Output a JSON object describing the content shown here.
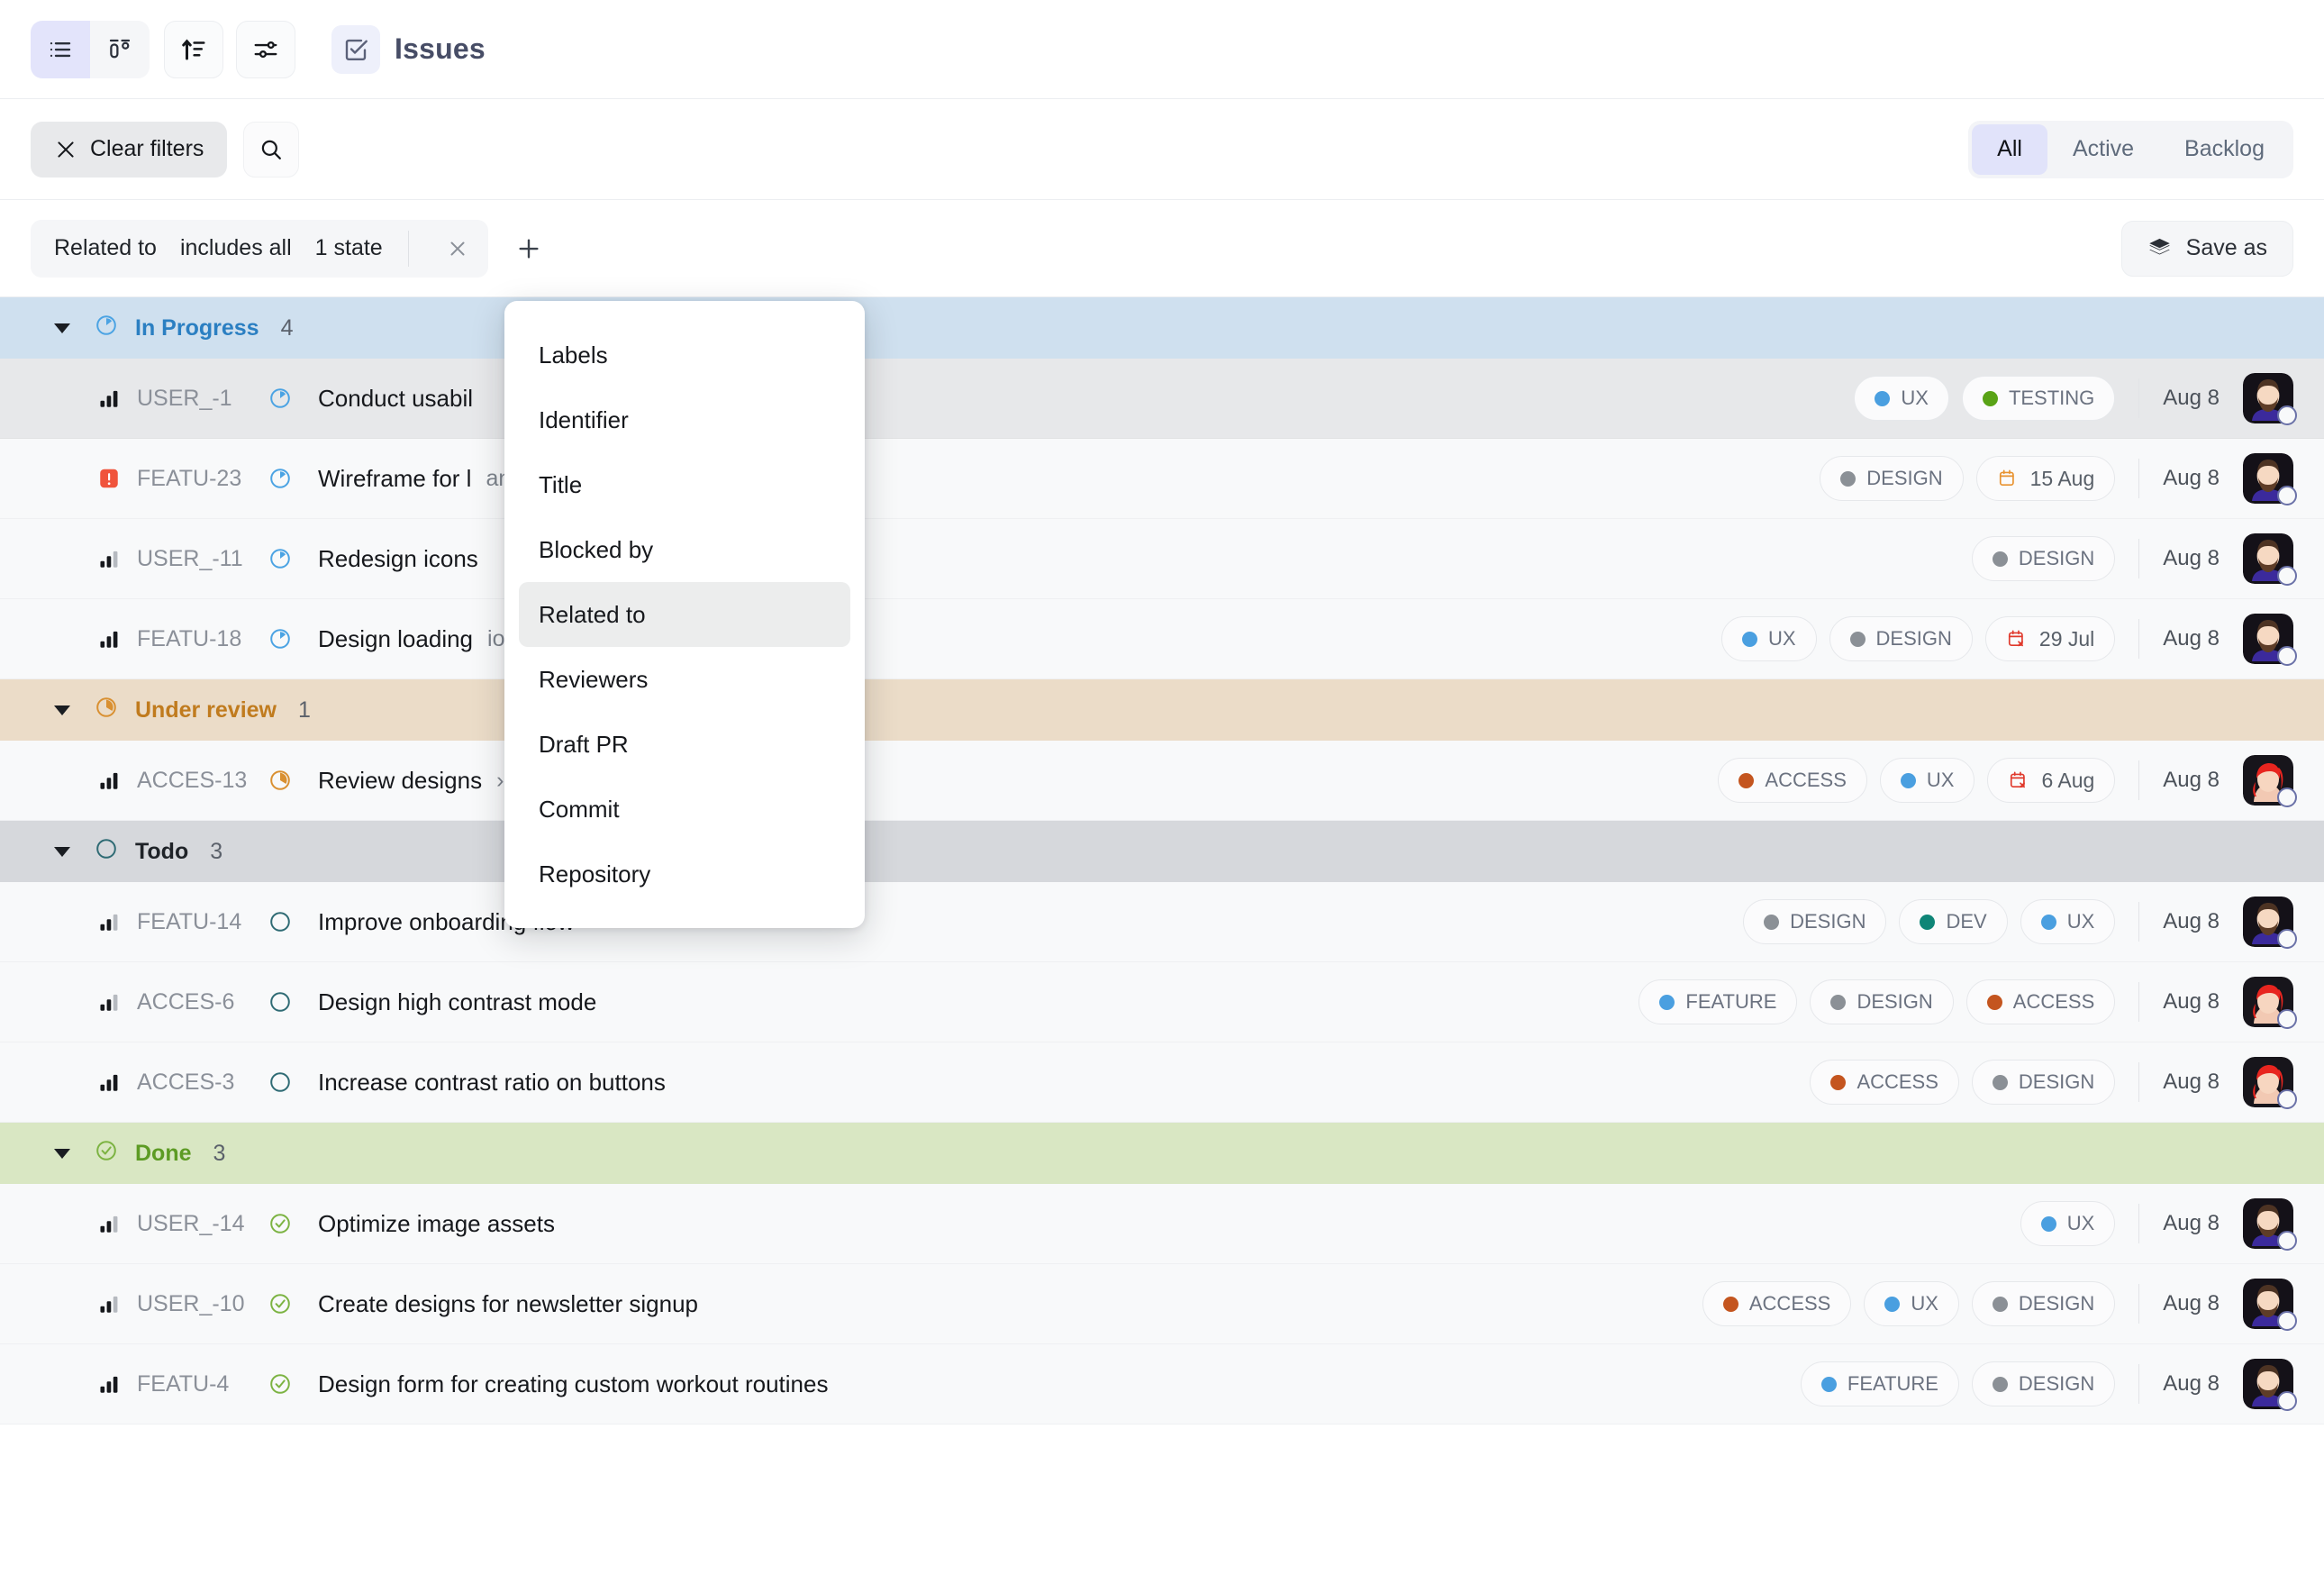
{
  "toolbar": {
    "views": [
      {
        "name": "list-view",
        "icon": "list-icon",
        "active": true
      },
      {
        "name": "board-view",
        "icon": "board-icon",
        "active": false
      }
    ],
    "sort_icon": "sort-ascending-icon",
    "filter_icon": "sliders-icon",
    "title_icon": "checkbox-check-icon",
    "title": "Issues"
  },
  "filterbar": {
    "clear_filters_label": "Clear filters",
    "clear_icon": "close-x-icon",
    "search_icon": "search-icon",
    "tabs": [
      {
        "label": "All",
        "active": true
      },
      {
        "label": "Active",
        "active": false
      },
      {
        "label": "Backlog",
        "active": false
      }
    ]
  },
  "active_filters": {
    "chip": {
      "field": "Related to",
      "operator": "includes all",
      "value": "1 state",
      "remove_icon": "close-x-icon"
    },
    "add_icon": "plus-icon",
    "save_as_label": "Save as",
    "save_as_icon": "layers-icon"
  },
  "dropdown": {
    "items": [
      {
        "label": "Labels",
        "active": false
      },
      {
        "label": "Identifier",
        "active": false
      },
      {
        "label": "Title",
        "active": false
      },
      {
        "label": "Blocked by",
        "active": false
      },
      {
        "label": "Related to",
        "active": true
      },
      {
        "label": "Reviewers",
        "active": false
      },
      {
        "label": "Draft PR",
        "active": false
      },
      {
        "label": "Commit",
        "active": false
      },
      {
        "label": "Repository",
        "active": false
      }
    ]
  },
  "colors": {
    "in_progress": "#4ba3e3",
    "under_review": "#d99031",
    "todo": "#2f6b74",
    "done": "#7cb342",
    "label_design": "#8b9096",
    "label_dev": "#0f8577",
    "label_ux": "#4a9fe0",
    "label_feature": "#4a9fe0",
    "label_access": "#c4551f",
    "label_testing": "#59a316",
    "urgent": "#f0543c",
    "due_soon": "#e8922f",
    "due_overdue": "#e0392c"
  },
  "groups": [
    {
      "name": "In Progress",
      "count": "4",
      "state_icon": "in-progress-icon",
      "color": "#2b7fc2",
      "bg": "#cfe0ef",
      "rows": [
        {
          "priority": "high",
          "identifier": "USER_-1",
          "state_icon": "in-progress-icon",
          "title": "Conduct usabil",
          "subtitle": "",
          "labels": [
            {
              "text": "UX",
              "color": "#4a9fe0"
            },
            {
              "text": "TESTING",
              "color": "#59a316"
            }
          ],
          "due": null,
          "date": "Aug 8",
          "avatar": "bearded-brown-hair",
          "hover": true
        },
        {
          "priority": "urgent",
          "identifier": "FEATU-23",
          "state_icon": "in-progress-icon",
          "title": "Wireframe for l",
          "subtitle": "animation for workouts",
          "labels": [
            {
              "text": "DESIGN",
              "color": "#8b9096"
            }
          ],
          "due": {
            "text": "15 Aug",
            "status": "soon",
            "icon": "calendar-icon"
          },
          "date": "Aug 8",
          "avatar": "bearded-brown-hair",
          "hover": false
        },
        {
          "priority": "medium",
          "identifier": "USER_-11",
          "state_icon": "in-progress-icon",
          "title": "Redesign icons",
          "subtitle": "",
          "labels": [
            {
              "text": "DESIGN",
              "color": "#8b9096"
            }
          ],
          "due": null,
          "date": "Aug 8",
          "avatar": "bearded-brown-hair",
          "hover": false
        },
        {
          "priority": "high",
          "identifier": "FEATU-18",
          "state_icon": "in-progress-icon",
          "title": "Design loading",
          "subtitle": "ion for workouts",
          "labels": [
            {
              "text": "UX",
              "color": "#4a9fe0"
            },
            {
              "text": "DESIGN",
              "color": "#8b9096"
            }
          ],
          "due": {
            "text": "29 Jul",
            "status": "overdue",
            "icon": "calendar-x-icon"
          },
          "date": "Aug 8",
          "avatar": "bearded-brown-hair",
          "hover": false
        }
      ]
    },
    {
      "name": "Under review",
      "count": "1",
      "state_icon": "under-review-icon",
      "color": "#c07b1e",
      "bg": "#ebdcc8",
      "rows": [
        {
          "priority": "high",
          "identifier": "ACCES-13",
          "state_icon": "under-review-icon",
          "title": "Review designs",
          "subtitle": "› Add loading animation for workouts",
          "labels": [
            {
              "text": "ACCESS",
              "color": "#c4551f"
            },
            {
              "text": "UX",
              "color": "#4a9fe0"
            }
          ],
          "due": {
            "text": "6 Aug",
            "status": "overdue",
            "icon": "calendar-x-icon"
          },
          "date": "Aug 8",
          "avatar": "red-hair",
          "hover": false
        }
      ]
    },
    {
      "name": "Todo",
      "count": "3",
      "state_icon": "todo-icon",
      "color": "#1f2328",
      "bg": "#d6d8dc",
      "rows": [
        {
          "priority": "medium",
          "identifier": "FEATU-14",
          "state_icon": "todo-icon",
          "title": "Improve onboarding flow",
          "subtitle": "",
          "labels": [
            {
              "text": "DESIGN",
              "color": "#8b9096"
            },
            {
              "text": "DEV",
              "color": "#0f8577"
            },
            {
              "text": "UX",
              "color": "#4a9fe0"
            }
          ],
          "due": null,
          "date": "Aug 8",
          "avatar": "bearded-brown-hair",
          "hover": false
        },
        {
          "priority": "medium",
          "identifier": "ACCES-6",
          "state_icon": "todo-icon",
          "title": "Design high contrast mode",
          "subtitle": "",
          "labels": [
            {
              "text": "FEATURE",
              "color": "#4a9fe0"
            },
            {
              "text": "DESIGN",
              "color": "#8b9096"
            },
            {
              "text": "ACCESS",
              "color": "#c4551f"
            }
          ],
          "due": null,
          "date": "Aug 8",
          "avatar": "red-hair",
          "hover": false
        },
        {
          "priority": "high",
          "identifier": "ACCES-3",
          "state_icon": "todo-icon",
          "title": "Increase contrast ratio on buttons",
          "subtitle": "",
          "labels": [
            {
              "text": "ACCESS",
              "color": "#c4551f"
            },
            {
              "text": "DESIGN",
              "color": "#8b9096"
            }
          ],
          "due": null,
          "date": "Aug 8",
          "avatar": "red-hair",
          "hover": false
        }
      ]
    },
    {
      "name": "Done",
      "count": "3",
      "state_icon": "done-icon",
      "color": "#5d9b24",
      "bg": "#d9e7c3",
      "rows": [
        {
          "priority": "medium",
          "identifier": "USER_-14",
          "state_icon": "done-icon",
          "title": "Optimize image assets",
          "subtitle": "",
          "labels": [
            {
              "text": "UX",
              "color": "#4a9fe0"
            }
          ],
          "due": null,
          "date": "Aug 8",
          "avatar": "bearded-brown-hair",
          "hover": false
        },
        {
          "priority": "medium",
          "identifier": "USER_-10",
          "state_icon": "done-icon",
          "title": "Create designs for newsletter signup",
          "subtitle": "",
          "labels": [
            {
              "text": "ACCESS",
              "color": "#c4551f"
            },
            {
              "text": "UX",
              "color": "#4a9fe0"
            },
            {
              "text": "DESIGN",
              "color": "#8b9096"
            }
          ],
          "due": null,
          "date": "Aug 8",
          "avatar": "bearded-brown-hair",
          "hover": false
        },
        {
          "priority": "high",
          "identifier": "FEATU-4",
          "state_icon": "done-icon",
          "title": "Design form for creating custom workout routines",
          "subtitle": "",
          "labels": [
            {
              "text": "FEATURE",
              "color": "#4a9fe0"
            },
            {
              "text": "DESIGN",
              "color": "#8b9096"
            }
          ],
          "due": null,
          "date": "Aug 8",
          "avatar": "bearded-brown-hair",
          "hover": false
        }
      ]
    }
  ]
}
